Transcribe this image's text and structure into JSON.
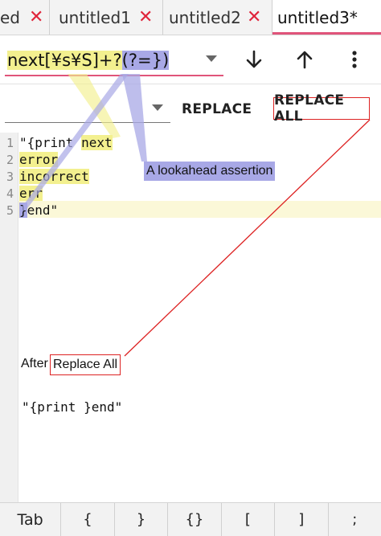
{
  "tabs": [
    {
      "label": "ed",
      "active": false
    },
    {
      "label": "untitled1",
      "active": false
    },
    {
      "label": "untitled2",
      "active": false
    },
    {
      "label": "untitled3*",
      "active": true
    }
  ],
  "tab_close_glyph": "✕",
  "search": {
    "part1": "next[¥s¥S]+?",
    "part2": "(?=})"
  },
  "toolbar": {
    "next_icon": "arrow-down-icon",
    "prev_icon": "arrow-up-icon",
    "menu_icon": "more-vertical-icon"
  },
  "replace": {
    "replace_label": "REPLACE",
    "replace_all_label": "REPLACE ALL"
  },
  "editor": {
    "line_numbers": [
      "1",
      "2",
      "3",
      "4",
      "5"
    ],
    "lines": {
      "l1_a": "\"{print ",
      "l1_b": "next",
      "l2": "error",
      "l3": "incorrect",
      "l4": "err",
      "l5_a": "}",
      "l5_b": "end\""
    }
  },
  "annotations": {
    "lookahead": "A lookahead assertion",
    "after": "After",
    "replace_all": "Replace All",
    "result": "\"{print }end\""
  },
  "keys": [
    "Tab",
    "{",
    "}",
    "{}",
    "[",
    "]",
    ";"
  ],
  "colors": {
    "accent": "#e0547a",
    "close": "#e0253b",
    "highlight_yellow": "#f3f08f",
    "highlight_purple": "#a8a8e6",
    "annotation_red": "#dd2222"
  }
}
